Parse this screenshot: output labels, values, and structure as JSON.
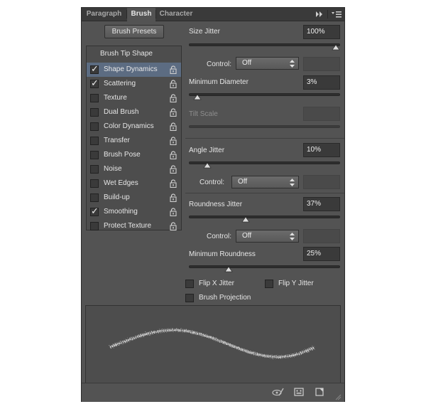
{
  "tabs": [
    {
      "label": "Paragraph",
      "active": false
    },
    {
      "label": "Brush",
      "active": true
    },
    {
      "label": "Character",
      "active": false
    }
  ],
  "tabbar_icons": [
    "expand-icon",
    "panel-menu-icon"
  ],
  "brush_presets_label": "Brush Presets",
  "brush_tip_shape_label": "Brush Tip Shape",
  "options": [
    {
      "label": "Shape Dynamics",
      "checked": true,
      "selected": true
    },
    {
      "label": "Scattering",
      "checked": true,
      "selected": false
    },
    {
      "label": "Texture",
      "checked": false,
      "selected": false
    },
    {
      "label": "Dual Brush",
      "checked": false,
      "selected": false
    },
    {
      "label": "Color Dynamics",
      "checked": false,
      "selected": false
    },
    {
      "label": "Transfer",
      "checked": false,
      "selected": false
    },
    {
      "label": "Brush Pose",
      "checked": false,
      "selected": false
    },
    {
      "label": "Noise",
      "checked": false,
      "selected": false
    },
    {
      "label": "Wet Edges",
      "checked": false,
      "selected": false
    },
    {
      "label": "Build-up",
      "checked": false,
      "selected": false
    },
    {
      "label": "Smoothing",
      "checked": true,
      "selected": false
    },
    {
      "label": "Protect Texture",
      "checked": false,
      "selected": false
    }
  ],
  "settings": {
    "size_jitter": {
      "label": "Size Jitter",
      "value": "100%",
      "level": 1.0
    },
    "control_label": "Control:",
    "control_1": "Off",
    "minimum_diameter": {
      "label": "Minimum Diameter",
      "value": "3%",
      "level": 0.03
    },
    "tilt_scale": {
      "label": "Tilt Scale",
      "value": ""
    },
    "angle_jitter": {
      "label": "Angle Jitter",
      "value": "10%",
      "level": 0.1
    },
    "control_2": "Off",
    "roundness_jitter": {
      "label": "Roundness Jitter",
      "value": "37%",
      "level": 0.37
    },
    "control_3": "Off",
    "minimum_roundness": {
      "label": "Minimum Roundness",
      "value": "25%",
      "level": 0.25
    },
    "flip_x_jitter": {
      "label": "Flip X Jitter",
      "checked": false
    },
    "flip_y_jitter": {
      "label": "Flip Y Jitter",
      "checked": false
    },
    "brush_projection": {
      "label": "Brush Projection",
      "checked": false
    }
  },
  "bottom_icons": [
    "toggle-live-tip-preview-icon",
    "brush-grid-icon",
    "new-brush-icon"
  ],
  "colors": {
    "panel": "#535353",
    "selected_row": "#5c6c82",
    "field": "#3a3a3a"
  }
}
